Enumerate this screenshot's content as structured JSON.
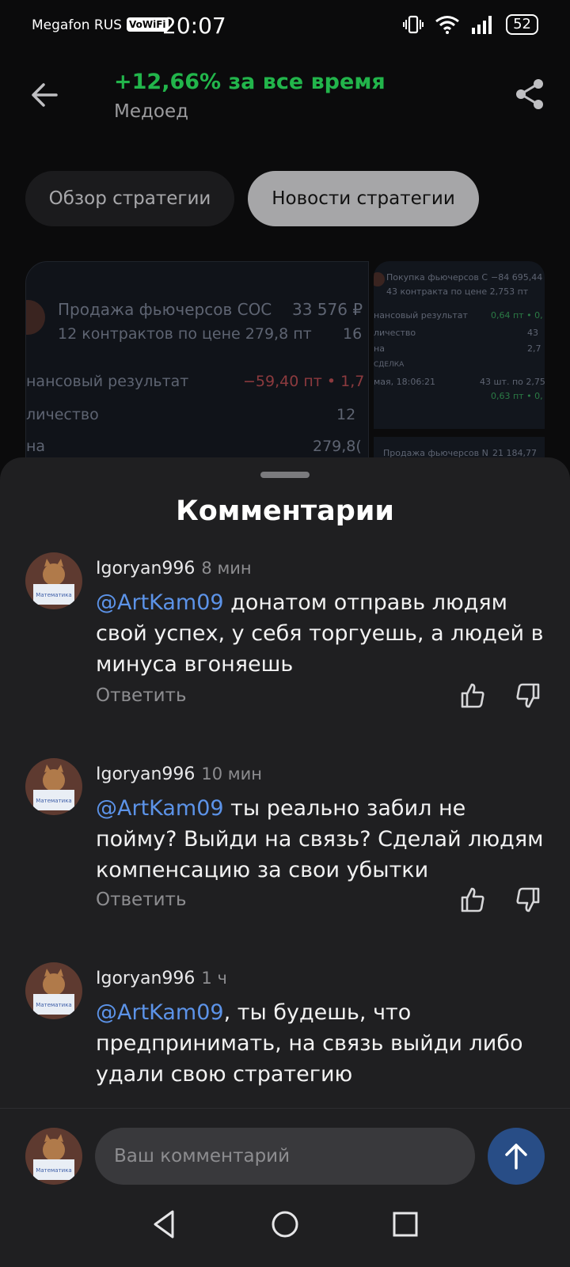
{
  "status_bar": {
    "carrier": "Megafon RUS",
    "vowifi": "VoWiFi",
    "time": "20:07",
    "battery": "52"
  },
  "header": {
    "title": "+12,66% за все время",
    "subtitle": "Медоед",
    "accent_color": "#22b54b"
  },
  "tabs": [
    {
      "label": "Обзор стратегии",
      "active": false
    },
    {
      "label": "Новости стратегии",
      "active": true
    }
  ],
  "cards": {
    "large": {
      "title": "Продажа фьючерсов СОС",
      "amount": "33 576 ₽",
      "subtitle": "12 контрактов по цене 279,8 пт",
      "subtitle_extra": "16",
      "rows": [
        {
          "label": "нансовый результат",
          "value": "−59,40 пт • 1,7"
        },
        {
          "label": "личество",
          "value": "12"
        },
        {
          "label": "на",
          "value": "279,8("
        }
      ]
    },
    "small": {
      "title": "Покупка фьючерсов С",
      "amount": "−84 695,44",
      "subtitle": "43 контракта по цене 2,753 пт",
      "rows": [
        {
          "label": "нансовый результат",
          "value": "0,64 пт • 0,"
        },
        {
          "label": "личество",
          "value": "43"
        },
        {
          "label": "на",
          "value": "2,7"
        }
      ],
      "section": "СДЕЛКА",
      "deal_date": "мая, 18:06:21",
      "deal_qty": "43 шт. по 2,75",
      "deal_result": "0,63 пт • 0,"
    },
    "small2": {
      "title": "Продажа фьючерсов N",
      "amount": "21 184,77"
    }
  },
  "comments_sheet": {
    "title": "Комментарии",
    "reply_label": "Ответить",
    "comments": [
      {
        "author": "Igoryan996",
        "time": "8 мин",
        "mention": "@ArtKam09",
        "text": " донатом отправь людям свой успех, у себя торгуешь, а людей в минуса вгоняешь"
      },
      {
        "author": "Igoryan996",
        "time": "10 мин",
        "mention": "@ArtKam09",
        "text": " ты реально забил не пойму? Выйди на связь? Сделай людям компенсацию за свои убытки"
      },
      {
        "author": "Igoryan996",
        "time": "1 ч",
        "mention": "@ArtKam09",
        "text": ", ты будешь, что предпринимать, на связь выйди либо удали свою стратегию"
      }
    ],
    "avatar_text": "Математика"
  },
  "input": {
    "placeholder": "Ваш комментарий"
  }
}
